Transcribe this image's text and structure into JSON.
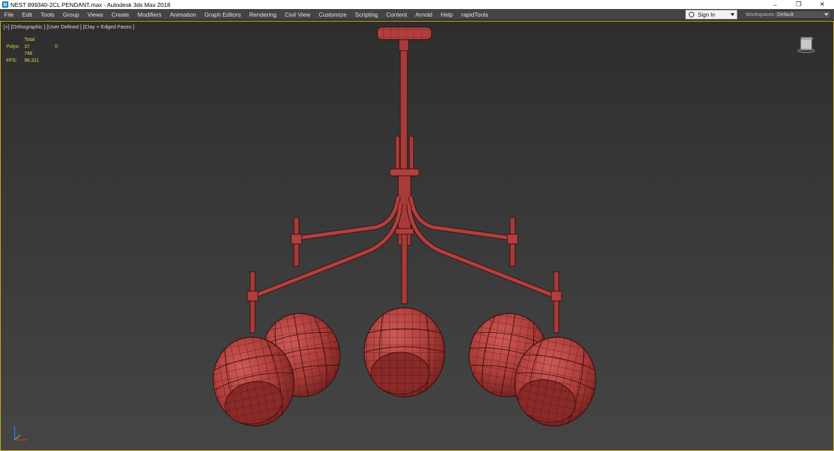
{
  "window": {
    "title": "NEST 899340-2CL PENDANT.max - Autodesk 3ds Max 2018",
    "controls": {
      "minimize": "–",
      "restore": "❐",
      "close": "✕"
    }
  },
  "menu": {
    "items": [
      "File",
      "Edit",
      "Tools",
      "Group",
      "Views",
      "Create",
      "Modifiers",
      "Animation",
      "Graph Editors",
      "Rendering",
      "Civil View",
      "Customize",
      "Scripting",
      "Content",
      "Arnold",
      "Help",
      "rapidTools"
    ],
    "sign_in": "Sign In",
    "workspaces_label": "Workspaces:",
    "workspace_value": "Default"
  },
  "viewport": {
    "label": "[+] [Orthographic ] [User Defined ] [Clay + Edged Faces ]",
    "stats": {
      "header": "Total",
      "polys_label": "Polys:",
      "polys_value": "37 748",
      "polys_selected": "0",
      "fps_label": "FPS:",
      "fps_value": "98,311"
    }
  },
  "colors": {
    "viewport_border": "#d8b31a",
    "stats_text": "#e3d64a",
    "model_clay": "#b0403e",
    "model_wire": "#3c0f0f"
  },
  "icons": {
    "app": "3ds-max-icon",
    "user": "user-icon",
    "viewcube": "viewcube-icon",
    "axis": "axis-tripod-icon"
  }
}
